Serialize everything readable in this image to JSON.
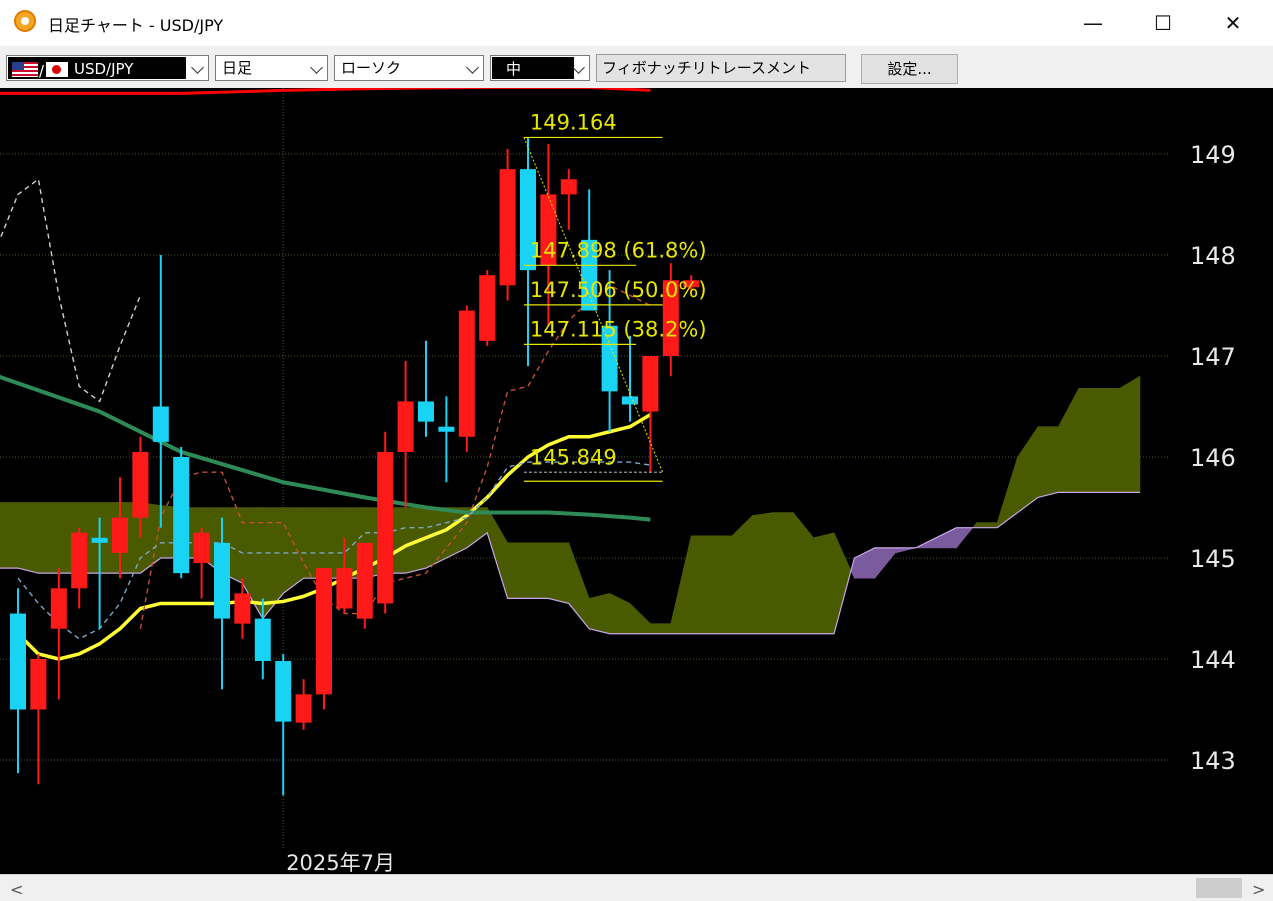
{
  "window": {
    "title": "日足チャート - USD/JPY",
    "minimize_glyph": "—",
    "maximize_glyph": "☐",
    "close_glyph": "✕"
  },
  "toolbar": {
    "pair_label": "USD/JPY",
    "timeframe": "日足",
    "chart_style": "ローソク",
    "size": "中",
    "indicator": "フィボナッチリトレースメント",
    "settings_button": "設定..."
  },
  "scrollbar": {
    "left_arrow": "<",
    "right_arrow": ">"
  },
  "colors": {
    "background": "#000000",
    "up_candle": "#ff1a1a",
    "down_candle": "#19d3f5",
    "fib_lines": "#e6e600",
    "ma_short": "#ffff33",
    "ma_long": "#2e8b57",
    "ma_top": "#ff0000",
    "cloud_bear": "#7a5c9e",
    "cloud_bull": "#4a5a00"
  },
  "chart_data": {
    "type": "candlestick",
    "symbol": "USD/JPY",
    "timeframe": "日足",
    "ylim": [
      142.0,
      149.7
    ],
    "y_ticks": [
      143,
      144,
      145,
      146,
      147,
      148,
      149
    ],
    "x_labels": [
      {
        "index": 13,
        "text": "2025年7月"
      }
    ],
    "grid": true,
    "candles": [
      {
        "o": 144.45,
        "h": 144.7,
        "l": 142.87,
        "c": 143.5
      },
      {
        "o": 143.5,
        "h": 144.05,
        "l": 142.76,
        "c": 144.0
      },
      {
        "o": 144.3,
        "h": 144.9,
        "l": 143.6,
        "c": 144.7
      },
      {
        "o": 144.7,
        "h": 145.3,
        "l": 144.5,
        "c": 145.25
      },
      {
        "o": 145.2,
        "h": 145.4,
        "l": 144.3,
        "c": 145.15
      },
      {
        "o": 145.05,
        "h": 145.8,
        "l": 144.8,
        "c": 145.4
      },
      {
        "o": 145.4,
        "h": 146.2,
        "l": 145.2,
        "c": 146.05
      },
      {
        "o": 146.5,
        "h": 148.0,
        "l": 145.3,
        "c": 146.15
      },
      {
        "o": 146.0,
        "h": 146.1,
        "l": 144.8,
        "c": 144.85
      },
      {
        "o": 144.95,
        "h": 145.3,
        "l": 144.6,
        "c": 145.25
      },
      {
        "o": 145.15,
        "h": 145.4,
        "l": 143.7,
        "c": 144.4
      },
      {
        "o": 144.35,
        "h": 144.8,
        "l": 144.2,
        "c": 144.65
      },
      {
        "o": 144.4,
        "h": 144.6,
        "l": 143.8,
        "c": 143.98
      },
      {
        "o": 143.98,
        "h": 144.05,
        "l": 142.65,
        "c": 143.38
      },
      {
        "o": 143.37,
        "h": 143.8,
        "l": 143.3,
        "c": 143.65
      },
      {
        "o": 143.65,
        "h": 144.6,
        "l": 143.5,
        "c": 144.9
      },
      {
        "o": 144.5,
        "h": 145.2,
        "l": 144.45,
        "c": 144.9
      },
      {
        "o": 144.4,
        "h": 144.65,
        "l": 144.3,
        "c": 145.15
      },
      {
        "o": 144.55,
        "h": 146.25,
        "l": 144.45,
        "c": 146.05
      },
      {
        "o": 146.05,
        "h": 146.95,
        "l": 145.5,
        "c": 146.55
      },
      {
        "o": 146.55,
        "h": 147.15,
        "l": 146.2,
        "c": 146.35
      },
      {
        "o": 146.3,
        "h": 146.6,
        "l": 145.75,
        "c": 146.25
      },
      {
        "o": 146.2,
        "h": 147.5,
        "l": 146.05,
        "c": 147.45
      },
      {
        "o": 147.15,
        "h": 147.85,
        "l": 147.1,
        "c": 147.8
      },
      {
        "o": 147.7,
        "h": 149.05,
        "l": 147.55,
        "c": 148.85
      },
      {
        "o": 148.85,
        "h": 149.164,
        "l": 146.9,
        "c": 147.85
      },
      {
        "o": 147.9,
        "h": 149.1,
        "l": 147.3,
        "c": 148.6
      },
      {
        "o": 148.6,
        "h": 148.85,
        "l": 148.25,
        "c": 148.75
      },
      {
        "o": 148.15,
        "h": 148.65,
        "l": 147.45,
        "c": 147.45
      },
      {
        "o": 147.3,
        "h": 147.85,
        "l": 146.25,
        "c": 146.65
      },
      {
        "o": 146.6,
        "h": 147.2,
        "l": 146.35,
        "c": 146.52
      },
      {
        "o": 146.45,
        "h": 147.0,
        "l": 145.849,
        "c": 147.0
      },
      {
        "o": 147.0,
        "h": 147.92,
        "l": 146.8,
        "c": 147.75
      },
      {
        "o": 147.68,
        "h": 147.8,
        "l": 147.62,
        "c": 147.75
      }
    ],
    "fibonacci": {
      "high": 149.164,
      "low": 145.849,
      "levels": [
        {
          "value": 149.164,
          "label": "149.164"
        },
        {
          "value": 147.898,
          "label": "147.898 (61.8%)"
        },
        {
          "value": 147.506,
          "label": "147.506 (50.0%)"
        },
        {
          "value": 147.115,
          "label": "147.115 (38.2%)"
        },
        {
          "value": 145.849,
          "label": "145.849"
        }
      ]
    },
    "series": [
      {
        "name": "",
        "color": "#ffff33",
        "style": "solid",
        "x": [
          0,
          1,
          2,
          3,
          4,
          5,
          6,
          7,
          8,
          9,
          10,
          11,
          12,
          13,
          14,
          15,
          16,
          17,
          18,
          19,
          20,
          21,
          22,
          23,
          24,
          25,
          26,
          27,
          28,
          29,
          30,
          31
        ],
        "y": [
          144.25,
          144.05,
          144.0,
          144.05,
          144.15,
          144.3,
          144.5,
          144.55,
          144.55,
          144.55,
          144.55,
          144.57,
          144.55,
          144.57,
          144.62,
          144.7,
          144.8,
          144.9,
          145.0,
          145.12,
          145.2,
          145.28,
          145.42,
          145.6,
          145.82,
          146.0,
          146.12,
          146.2,
          146.2,
          146.25,
          146.3,
          146.42
        ]
      },
      {
        "name": "",
        "color": "#2e8b57",
        "style": "solid",
        "x": [
          -1,
          4,
          8,
          13,
          17,
          20,
          22,
          24,
          26,
          28,
          30,
          31
        ],
        "y": [
          146.8,
          146.45,
          146.05,
          145.75,
          145.6,
          145.5,
          145.45,
          145.45,
          145.45,
          145.43,
          145.4,
          145.38
        ]
      },
      {
        "name": "",
        "color": "#ff0000",
        "style": "solid",
        "x": [
          -1,
          8,
          13,
          18,
          23,
          28,
          31
        ],
        "y": [
          149.6,
          149.6,
          149.63,
          149.65,
          149.66,
          149.66,
          149.63
        ]
      },
      {
        "name": "",
        "color": "#d0d0d0",
        "style": "dashed",
        "x": [
          -1,
          0,
          1,
          2,
          3,
          4,
          5,
          6
        ],
        "y": [
          148.1,
          148.6,
          148.75,
          147.6,
          146.7,
          146.55,
          147.1,
          147.6
        ]
      },
      {
        "name": "",
        "color": "#c0503a",
        "style": "dashed",
        "x": [
          6,
          7,
          8,
          9,
          10,
          11,
          12,
          13,
          14,
          15,
          16,
          17,
          18,
          19,
          20,
          21,
          22,
          23,
          24,
          25,
          26,
          27,
          28,
          29,
          30,
          31
        ],
        "y": [
          144.3,
          145.4,
          145.8,
          145.85,
          145.85,
          145.35,
          145.35,
          145.35,
          144.95,
          144.6,
          144.45,
          144.45,
          144.75,
          144.8,
          144.85,
          145.1,
          145.35,
          145.9,
          146.65,
          146.7,
          147.05,
          147.35,
          147.55,
          147.7,
          147.6,
          147.5
        ]
      },
      {
        "name": "",
        "color": "#7aa8c8",
        "style": "dashed",
        "x": [
          0,
          1,
          2,
          3,
          4,
          5,
          6,
          7,
          8,
          9,
          10,
          11,
          12,
          13,
          14,
          15,
          16,
          17,
          18,
          19,
          20,
          21,
          22,
          23,
          24,
          25,
          26,
          27,
          28,
          29,
          30,
          31
        ],
        "y": [
          144.8,
          144.55,
          144.35,
          144.2,
          144.3,
          144.55,
          145.0,
          145.15,
          145.15,
          145.15,
          145.15,
          145.05,
          145.05,
          145.05,
          145.05,
          145.05,
          145.05,
          145.25,
          145.25,
          145.3,
          145.3,
          145.35,
          145.4,
          145.6,
          145.9,
          145.95,
          145.95,
          145.95,
          145.95,
          145.95,
          145.95,
          145.92
        ]
      }
    ],
    "cloud": {
      "x": [
        -1,
        0,
        1,
        2,
        3,
        4,
        5,
        6,
        7,
        8,
        9,
        10,
        11,
        12,
        13,
        14,
        15,
        16,
        17,
        18,
        19,
        20,
        21,
        22,
        23,
        24,
        25,
        26,
        27,
        28,
        29,
        30,
        31,
        32,
        33,
        34,
        35,
        36,
        37,
        38,
        39,
        40,
        41,
        42,
        43,
        44,
        45,
        46,
        47,
        48,
        49,
        50,
        51,
        52,
        53,
        54,
        55
      ],
      "span_a": [
        145.55,
        145.55,
        145.55,
        145.55,
        145.55,
        145.55,
        145.55,
        145.55,
        145.52,
        145.5,
        145.5,
        145.5,
        145.5,
        145.5,
        145.5,
        145.5,
        145.5,
        145.5,
        145.5,
        145.5,
        145.5,
        145.5,
        145.5,
        145.5,
        145.5,
        145.15,
        145.15,
        145.15,
        145.15,
        144.6,
        144.65,
        144.55,
        144.35,
        144.35,
        145.22,
        145.22,
        145.22,
        145.42,
        145.45,
        145.45,
        145.2,
        145.25,
        144.8,
        144.8,
        145.05,
        145.1,
        145.1,
        145.1,
        145.35,
        145.35,
        146.0,
        146.3,
        146.3,
        146.68,
        146.68,
        146.68,
        146.8,
        146.73,
        146.73
      ],
      "span_b": [
        144.9,
        144.9,
        144.85,
        144.85,
        144.85,
        144.85,
        144.85,
        144.85,
        145.0,
        145.0,
        145.0,
        144.85,
        144.75,
        144.4,
        144.65,
        144.8,
        144.8,
        144.8,
        144.8,
        144.85,
        144.85,
        144.9,
        145.0,
        145.1,
        145.25,
        144.6,
        144.6,
        144.6,
        144.55,
        144.3,
        144.25,
        144.25,
        144.25,
        144.25,
        144.25,
        144.25,
        144.25,
        144.25,
        144.25,
        144.25,
        144.25,
        144.25,
        145.0,
        145.1,
        145.1,
        145.1,
        145.2,
        145.3,
        145.3,
        145.3,
        145.45,
        145.6,
        145.65,
        145.65,
        145.65,
        145.65,
        145.65,
        145.65,
        145.65
      ]
    }
  }
}
